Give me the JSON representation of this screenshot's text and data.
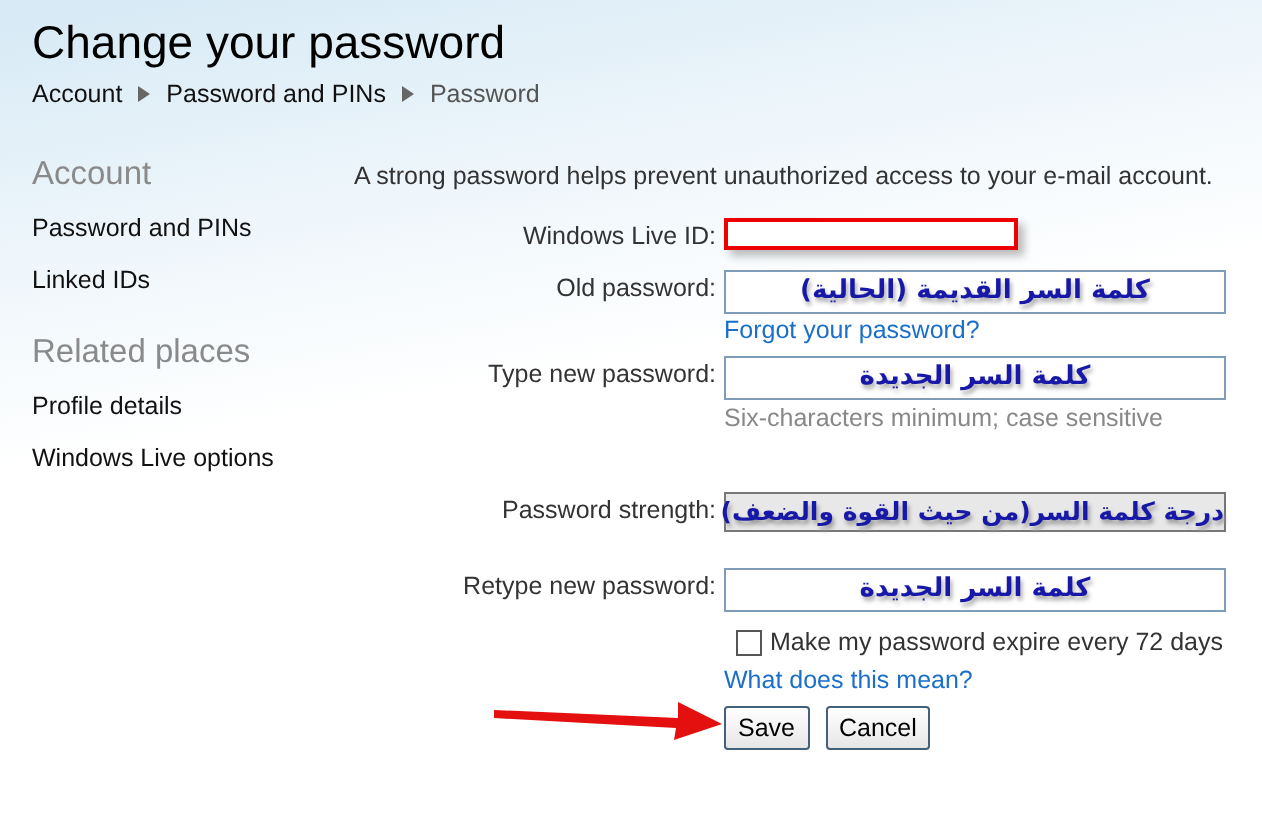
{
  "page": {
    "title": "Change your password"
  },
  "breadcrumb": [
    {
      "label": "Account",
      "current": false
    },
    {
      "label": "Password and PINs",
      "current": false
    },
    {
      "label": "Password",
      "current": true
    }
  ],
  "sidebar": {
    "sections": [
      {
        "heading": "Account",
        "items": [
          "Password and PINs",
          "Linked IDs"
        ]
      },
      {
        "heading": "Related places",
        "items": [
          "Profile details",
          "Windows Live options"
        ]
      }
    ]
  },
  "form": {
    "intro": "A strong password helps prevent unauthorized access to your e-mail account.",
    "fields": [
      {
        "kind": "input",
        "label": "Windows Live ID:",
        "highlighted": true
      },
      {
        "kind": "input",
        "label": "Old password:",
        "value": "كلمة السر القديمة (الحالية)",
        "link": "Forgot your password?",
        "highlighted": false
      },
      {
        "kind": "input",
        "label": "Type new password:",
        "value": "كلمة السر الجديدة",
        "hint": "Six-characters minimum; case sensitive",
        "highlighted": false
      },
      {
        "kind": "meter",
        "label": "Password strength:",
        "value": "درجة كلمة السر(من حيث القوة والضعف)"
      },
      {
        "kind": "input",
        "label": "Retype new password:",
        "value": "كلمة السر الجديدة",
        "highlighted": false
      }
    ],
    "expire": {
      "label": "Make my password expire every 72 days",
      "checked": false
    },
    "help_link": "What does this mean?",
    "buttons": [
      "Save",
      "Cancel"
    ]
  },
  "annotation": {
    "kind": "arrow"
  }
}
